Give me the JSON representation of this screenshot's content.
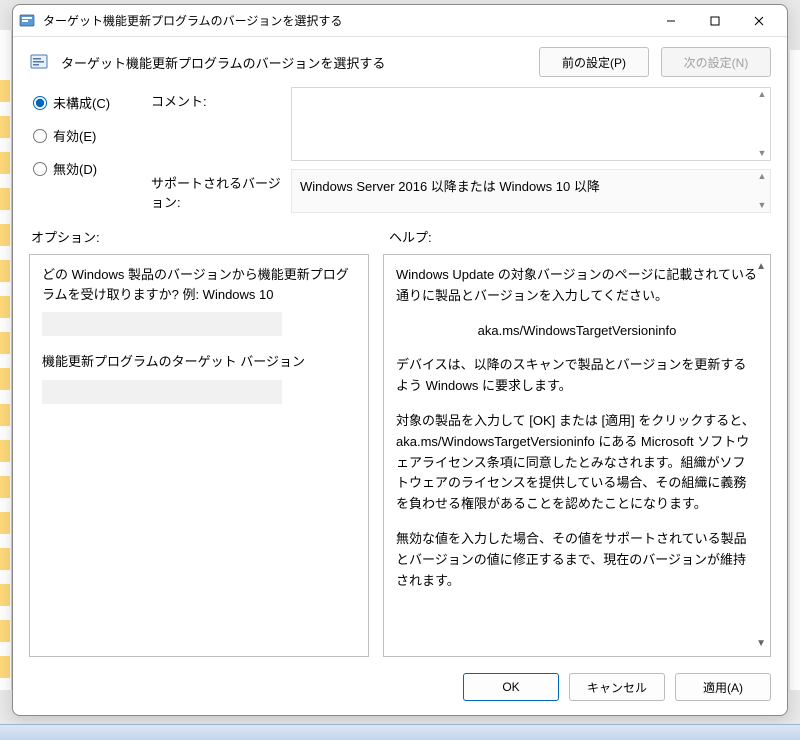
{
  "titlebar": {
    "title": "ターゲット機能更新プログラムのバージョンを選択する"
  },
  "header": {
    "title": "ターゲット機能更新プログラムのバージョンを選択する",
    "prev_btn": "前の設定(P)",
    "next_btn": "次の設定(N)"
  },
  "radios": {
    "not_configured": "未構成(C)",
    "enabled": "有効(E)",
    "disabled": "無効(D)"
  },
  "fields": {
    "comment_label": "コメント:",
    "comment_value": "",
    "supported_label": "サポートされるバージョン:",
    "supported_value": "Windows Server 2016 以降または Windows 10 以降"
  },
  "sections": {
    "options_label": "オプション:",
    "help_label": "ヘルプ:"
  },
  "options": {
    "question1": "どの Windows 製品のバージョンから機能更新プログラムを受け取りますか? 例: Windows 10",
    "input1_value": "",
    "question2": "機能更新プログラムのターゲット バージョン",
    "input2_value": ""
  },
  "help": {
    "p1": "Windows Update の対象バージョンのページに記載されている通りに製品とバージョンを入力してください。",
    "p2": "aka.ms/WindowsTargetVersioninfo",
    "p3": "デバイスは、以降のスキャンで製品とバージョンを更新するよう Windows に要求します。",
    "p4": "対象の製品を入力して [OK] または [適用] をクリックすると、aka.ms/WindowsTargetVersioninfo にある Microsoft ソフトウェアライセンス条項に同意したとみなされます。組織がソフトウェアのライセンスを提供している場合、その組織に義務を負わせる権限があることを認めたことになります。",
    "p5": "無効な値を入力した場合、その値をサポートされている製品とバージョンの値に修正するまで、現在のバージョンが維持されます。"
  },
  "footer": {
    "ok": "OK",
    "cancel": "キャンセル",
    "apply": "適用(A)"
  }
}
